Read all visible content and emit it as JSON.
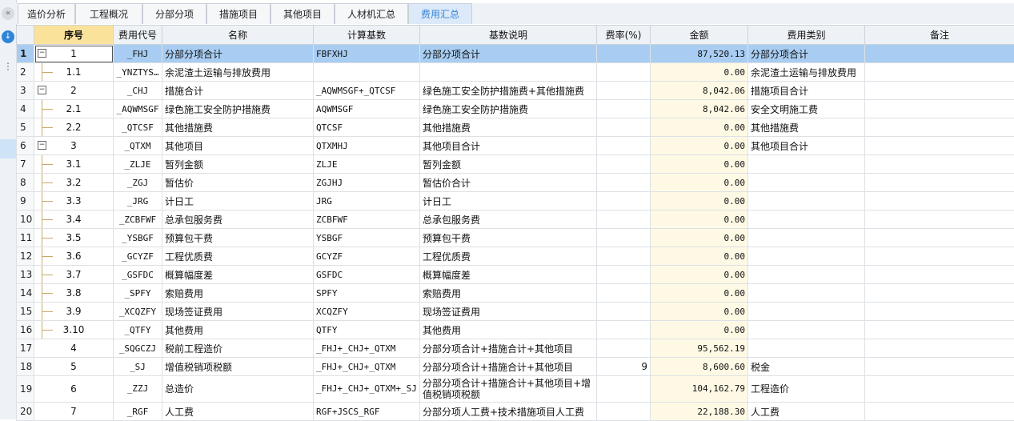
{
  "tabs": [
    {
      "label": "造价分析"
    },
    {
      "label": "工程概况"
    },
    {
      "label": "分部分项"
    },
    {
      "label": "措施项目"
    },
    {
      "label": "其他项目"
    },
    {
      "label": "人材机汇总"
    },
    {
      "label": "费用汇总"
    }
  ],
  "active_tab": "费用汇总",
  "columns": {
    "seq": "序号",
    "code": "费用代号",
    "name": "名称",
    "base": "计算基数",
    "desc": "基数说明",
    "rate": "费率(%)",
    "amount": "金额",
    "category": "费用类别",
    "note": "备注"
  },
  "rows": [
    {
      "rn": "1",
      "seq": "1",
      "code": "_FHJ",
      "name": "分部分项合计",
      "base": "FBFXHJ",
      "desc": "分部分项合计",
      "rate": "",
      "amount": "87,520.13",
      "category": "分部分项合计",
      "note": ""
    },
    {
      "rn": "2",
      "seq": "1.1",
      "code": "_YNZTYS…",
      "name": "余泥渣土运输与排放费用",
      "base": "",
      "desc": "",
      "rate": "",
      "amount": "0.00",
      "category": "余泥渣土运输与排放费用",
      "note": ""
    },
    {
      "rn": "3",
      "seq": "2",
      "code": "_CHJ",
      "name": "措施合计",
      "base": "_AQWMSGF+_QTCSF",
      "desc": "绿色施工安全防护措施费+其他措施费",
      "rate": "",
      "amount": "8,042.06",
      "category": "措施项目合计",
      "note": ""
    },
    {
      "rn": "4",
      "seq": "2.1",
      "code": "_AQWMSGF",
      "name": "绿色施工安全防护措施费",
      "base": "AQWMSGF",
      "desc": "绿色施工安全防护措施费",
      "rate": "",
      "amount": "8,042.06",
      "category": "安全文明施工费",
      "note": ""
    },
    {
      "rn": "5",
      "seq": "2.2",
      "code": "_QTCSF",
      "name": "其他措施费",
      "base": "QTCSF",
      "desc": "其他措施费",
      "rate": "",
      "amount": "0.00",
      "category": "其他措施费",
      "note": ""
    },
    {
      "rn": "6",
      "seq": "3",
      "code": "_QTXM",
      "name": "其他项目",
      "base": "QTXMHJ",
      "desc": "其他项目合计",
      "rate": "",
      "amount": "0.00",
      "category": "其他项目合计",
      "note": ""
    },
    {
      "rn": "7",
      "seq": "3.1",
      "code": "_ZLJE",
      "name": "暂列金额",
      "base": "ZLJE",
      "desc": "暂列金额",
      "rate": "",
      "amount": "0.00",
      "category": "",
      "note": ""
    },
    {
      "rn": "8",
      "seq": "3.2",
      "code": "_ZGJ",
      "name": "暂估价",
      "base": "ZGJHJ",
      "desc": "暂估价合计",
      "rate": "",
      "amount": "0.00",
      "category": "",
      "note": ""
    },
    {
      "rn": "9",
      "seq": "3.3",
      "code": "_JRG",
      "name": "计日工",
      "base": "JRG",
      "desc": "计日工",
      "rate": "",
      "amount": "0.00",
      "category": "",
      "note": ""
    },
    {
      "rn": "10",
      "seq": "3.4",
      "code": "_ZCBFWF",
      "name": "总承包服务费",
      "base": "ZCBFWF",
      "desc": "总承包服务费",
      "rate": "",
      "amount": "0.00",
      "category": "",
      "note": ""
    },
    {
      "rn": "11",
      "seq": "3.5",
      "code": "_YSBGF",
      "name": "预算包干费",
      "base": "YSBGF",
      "desc": "预算包干费",
      "rate": "",
      "amount": "0.00",
      "category": "",
      "note": ""
    },
    {
      "rn": "12",
      "seq": "3.6",
      "code": "_GCYZF",
      "name": "工程优质费",
      "base": "GCYZF",
      "desc": "工程优质费",
      "rate": "",
      "amount": "0.00",
      "category": "",
      "note": ""
    },
    {
      "rn": "13",
      "seq": "3.7",
      "code": "_GSFDC",
      "name": "概算幅度差",
      "base": "GSFDC",
      "desc": "概算幅度差",
      "rate": "",
      "amount": "0.00",
      "category": "",
      "note": ""
    },
    {
      "rn": "14",
      "seq": "3.8",
      "code": "_SPFY",
      "name": "索赔费用",
      "base": "SPFY",
      "desc": "索赔费用",
      "rate": "",
      "amount": "0.00",
      "category": "",
      "note": ""
    },
    {
      "rn": "15",
      "seq": "3.9",
      "code": "_XCQZFY",
      "name": "现场签证费用",
      "base": "XCQZFY",
      "desc": "现场签证费用",
      "rate": "",
      "amount": "0.00",
      "category": "",
      "note": ""
    },
    {
      "rn": "16",
      "seq": "3.10",
      "code": "_QTFY",
      "name": "其他费用",
      "base": "QTFY",
      "desc": "其他费用",
      "rate": "",
      "amount": "0.00",
      "category": "",
      "note": ""
    },
    {
      "rn": "17",
      "seq": "4",
      "code": "_SQGCZJ",
      "name": "税前工程造价",
      "base": "_FHJ+_CHJ+_QTXM",
      "desc": "分部分项合计+措施合计+其他项目",
      "rate": "",
      "amount": "95,562.19",
      "category": "",
      "note": ""
    },
    {
      "rn": "18",
      "seq": "5",
      "code": "_SJ",
      "name": "增值税销项税额",
      "base": "_FHJ+_CHJ+_QTXM",
      "desc": "分部分项合计+措施合计+其他项目",
      "rate": "9",
      "amount": "8,600.60",
      "category": "税金",
      "note": ""
    },
    {
      "rn": "19",
      "seq": "6",
      "code": "_ZZJ",
      "name": "总造价",
      "base": "_FHJ+_CHJ+_QTXM+_SJ",
      "desc": "分部分项合计+措施合计+其他项目+增值税销项税额",
      "rate": "",
      "amount": "104,162.79",
      "category": "工程造价",
      "note": ""
    },
    {
      "rn": "20",
      "seq": "7",
      "code": "_RGF",
      "name": "人工费",
      "base": "RGF+JSCS_RGF",
      "desc": "分部分项人工费+技术措施项目人工费",
      "rate": "",
      "amount": "22,188.30",
      "category": "人工费",
      "note": ""
    }
  ]
}
